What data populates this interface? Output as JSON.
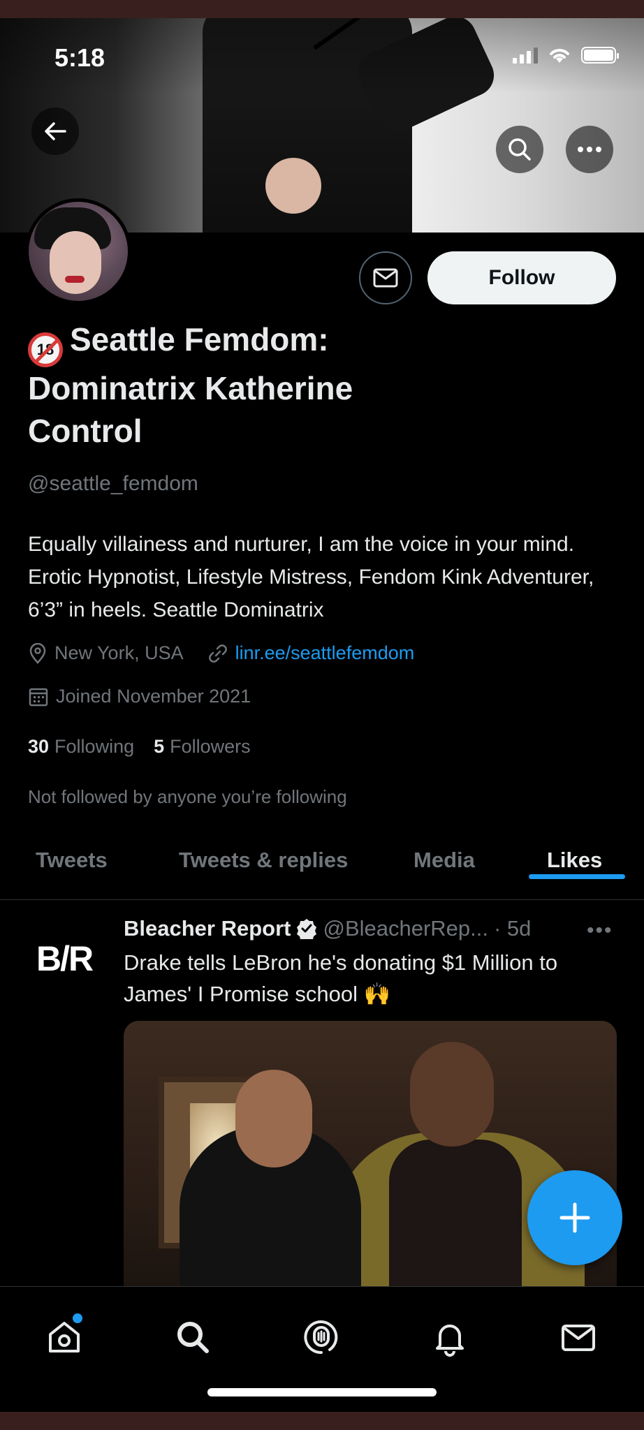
{
  "status_bar": {
    "time": "5:18"
  },
  "profile": {
    "display_name": "Seattle Femdom: Dominatrix Katherine Control",
    "badge_text": "18",
    "handle": "@seattle_femdom",
    "bio": "Equally villainess and nurturer, I am the voice in your mind. Erotic Hypnotist, Lifestyle Mistress, Fendom Kink Adventurer, 6’3” in heels. Seattle Dominatrix",
    "location": "New York, USA",
    "link": "linr.ee/seattlefemdom",
    "joined": "Joined November 2021",
    "following_count": "30",
    "following_label": "Following",
    "followers_count": "5",
    "followers_label": "Followers",
    "not_followed_text": "Not followed by anyone you’re following",
    "follow_button": "Follow"
  },
  "tabs": [
    {
      "label": "Tweets",
      "active": false
    },
    {
      "label": "Tweets & replies",
      "active": false
    },
    {
      "label": "Media",
      "active": false
    },
    {
      "label": "Likes",
      "active": true
    }
  ],
  "tweet": {
    "logo_text": "B/R",
    "author": "Bleacher Report",
    "handle": "@BleacherRep...",
    "time": "· 5d",
    "more": "•••",
    "text": "Drake tells LeBron he's donating $1 Million to James' I Promise school 🙌"
  },
  "colors": {
    "accent": "#1d9bf0",
    "background": "#000000",
    "text_primary": "#e7e9ea",
    "text_secondary": "#71767b"
  },
  "icons": {
    "nav": [
      "home-icon",
      "search-icon",
      "spaces-icon",
      "notifications-icon",
      "messages-icon"
    ],
    "fab": "compose-plus-icon"
  }
}
